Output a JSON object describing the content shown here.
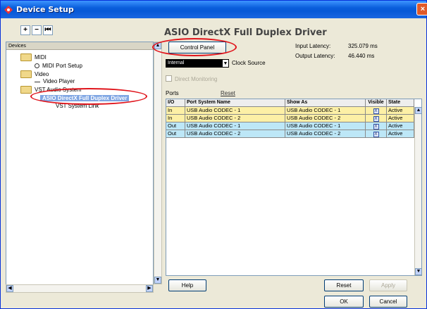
{
  "window": {
    "title": "Device Setup",
    "close_glyph": "×"
  },
  "toolbar": {
    "add": "+",
    "remove": "−",
    "reset": "⏮"
  },
  "tree": {
    "header": "Devices",
    "items": [
      {
        "label": "MIDI",
        "kind": "folder"
      },
      {
        "label": "MIDI Port Setup",
        "kind": "leaf"
      },
      {
        "label": "Video",
        "kind": "folder"
      },
      {
        "label": "Video Player",
        "kind": "leaf"
      },
      {
        "label": "VST Audio System",
        "kind": "folder"
      },
      {
        "label": "ASIO DirectX Full Duplex Driver",
        "kind": "selected"
      },
      {
        "label": "VST System Link",
        "kind": "leaf"
      }
    ]
  },
  "driver": {
    "title": "ASIO DirectX Full Duplex Driver",
    "control_panel": "Control Panel",
    "input_latency_label": "Input Latency:",
    "input_latency_value": "325.079 ms",
    "output_latency_label": "Output Latency:",
    "output_latency_value": "46.440 ms",
    "clock_value": "Internal",
    "clock_label": "Clock Source",
    "direct_monitoring": "Direct Monitoring"
  },
  "ports": {
    "label": "Ports",
    "reset": "Reset",
    "columns": [
      "I/O",
      "Port System Name",
      "Show As",
      "Visible",
      "State"
    ],
    "rows": [
      {
        "io": "In",
        "name": "USB Audio CODEC  - 1",
        "show_as": "USB Audio CODEC  - 1",
        "visible": "X",
        "state": "Active"
      },
      {
        "io": "In",
        "name": "USB Audio CODEC  - 2",
        "show_as": "USB Audio CODEC  - 2",
        "visible": "X",
        "state": "Active"
      },
      {
        "io": "Out",
        "name": "USB Audio CODEC  - 1",
        "show_as": "USB Audio CODEC  - 1",
        "visible": "X",
        "state": "Active"
      },
      {
        "io": "Out",
        "name": "USB Audio CODEC  - 2",
        "show_as": "USB Audio CODEC  - 2",
        "visible": "X",
        "state": "Active"
      }
    ]
  },
  "buttons": {
    "help": "Help",
    "reset": "Reset",
    "apply": "Apply",
    "ok": "OK",
    "cancel": "Cancel"
  },
  "colors": {
    "annotation": "#e0141b",
    "input_row": "#fdf0a6",
    "output_row": "#bde7f7"
  }
}
